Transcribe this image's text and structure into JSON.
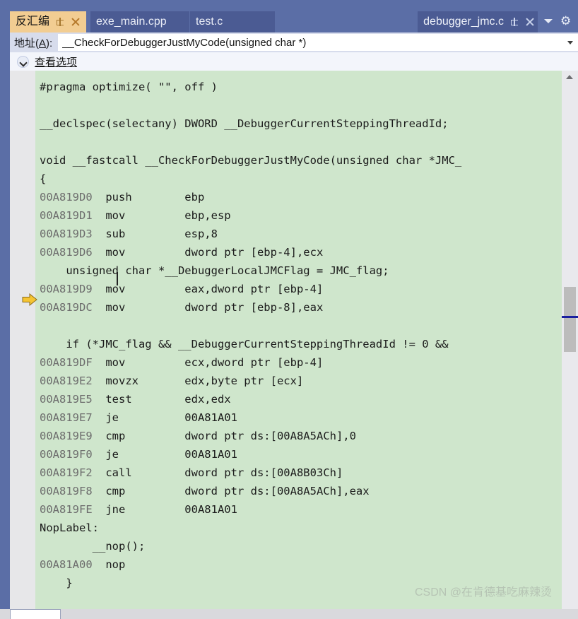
{
  "window": {
    "accent_blue": "#5b6ea6",
    "active_tab_bg": "#f2cd92",
    "code_bg": "#cfe6cc"
  },
  "tabs": {
    "active": {
      "label": "反汇编",
      "pin_icon": "pin-icon",
      "close_icon": "close-icon"
    },
    "others": [
      {
        "label": "exe_main.cpp"
      },
      {
        "label": "test.c"
      }
    ],
    "right_tab": {
      "label": "debugger_jmc.c",
      "pin_icon": "pin-icon",
      "close_icon": "close-icon"
    },
    "overflow_icon": "chevron-down-icon",
    "settings_icon": "gear-icon"
  },
  "address_bar": {
    "label_prefix": "地址(",
    "label_accel": "A",
    "label_suffix": "): ",
    "value": "__CheckForDebuggerJustMyCode(unsigned char *)",
    "placeholder": "地址",
    "dropdown_icon": "chevron-down-icon"
  },
  "view_options": {
    "label": "查看选项",
    "chevron_icon": "chevron-down-icon"
  },
  "editor": {
    "instruction_pointer_icon": "yellow-right-arrow-icon",
    "instruction_pointer_color": "#f5c432",
    "lines": [
      {
        "text": "#pragma optimize( \"\", off )",
        "type": "source"
      },
      {
        "text": "",
        "type": "blank"
      },
      {
        "text": "__declspec(selectany) DWORD __DebuggerCurrentSteppingThreadId;",
        "type": "source"
      },
      {
        "text": "",
        "type": "blank"
      },
      {
        "text": "void __fastcall __CheckForDebuggerJustMyCode(unsigned char *JMC_",
        "type": "source"
      },
      {
        "text": "{",
        "type": "source"
      },
      {
        "addr": "00A819D0",
        "mnemonic": "push",
        "operands": "ebp",
        "type": "asm"
      },
      {
        "addr": "00A819D1",
        "mnemonic": "mov",
        "operands": "ebp,esp",
        "type": "asm",
        "current": true
      },
      {
        "addr": "00A819D3",
        "mnemonic": "sub",
        "operands": "esp,8",
        "type": "asm"
      },
      {
        "addr": "00A819D6",
        "mnemonic": "mov",
        "operands": "dword ptr [ebp-4],ecx",
        "type": "asm"
      },
      {
        "text": "    unsigned char *__DebuggerLocalJMCFlag = JMC_flag;",
        "type": "source"
      },
      {
        "addr": "00A819D9",
        "mnemonic": "mov",
        "operands": "eax,dword ptr [ebp-4]",
        "type": "asm"
      },
      {
        "addr": "00A819DC",
        "mnemonic": "mov",
        "operands": "dword ptr [ebp-8],eax",
        "type": "asm"
      },
      {
        "text": "",
        "type": "blank"
      },
      {
        "text": "    if (*JMC_flag && __DebuggerCurrentSteppingThreadId != 0 && ",
        "type": "source"
      },
      {
        "addr": "00A819DF",
        "mnemonic": "mov",
        "operands": "ecx,dword ptr [ebp-4]",
        "type": "asm"
      },
      {
        "addr": "00A819E2",
        "mnemonic": "movzx",
        "operands": "edx,byte ptr [ecx]",
        "type": "asm"
      },
      {
        "addr": "00A819E5",
        "mnemonic": "test",
        "operands": "edx,edx",
        "type": "asm"
      },
      {
        "addr": "00A819E7",
        "mnemonic": "je",
        "operands": "00A81A01",
        "type": "asm"
      },
      {
        "addr": "00A819E9",
        "mnemonic": "cmp",
        "operands": "dword ptr ds:[00A8A5ACh],0",
        "type": "asm"
      },
      {
        "addr": "00A819F0",
        "mnemonic": "je",
        "operands": "00A81A01",
        "type": "asm"
      },
      {
        "addr": "00A819F2",
        "mnemonic": "call",
        "operands": "dword ptr ds:[00A8B03Ch]",
        "type": "asm"
      },
      {
        "addr": "00A819F8",
        "mnemonic": "cmp",
        "operands": "dword ptr ds:[00A8A5ACh],eax",
        "type": "asm"
      },
      {
        "addr": "00A819FE",
        "mnemonic": "jne",
        "operands": "00A81A01",
        "type": "asm"
      },
      {
        "text": "NopLabel:",
        "type": "source"
      },
      {
        "text": "        __nop();",
        "type": "source"
      },
      {
        "addr": "00A81A00",
        "mnemonic": "nop",
        "operands": "",
        "type": "asm"
      },
      {
        "text": "    }",
        "type": "source"
      }
    ]
  },
  "scrollbar": {
    "up_arrow_icon": "triangle-up-icon",
    "thumb": "scroll-thumb",
    "marker_color": "#1a1fa0"
  },
  "watermark": {
    "text": "CSDN @在肯德基吃麻辣烫"
  }
}
